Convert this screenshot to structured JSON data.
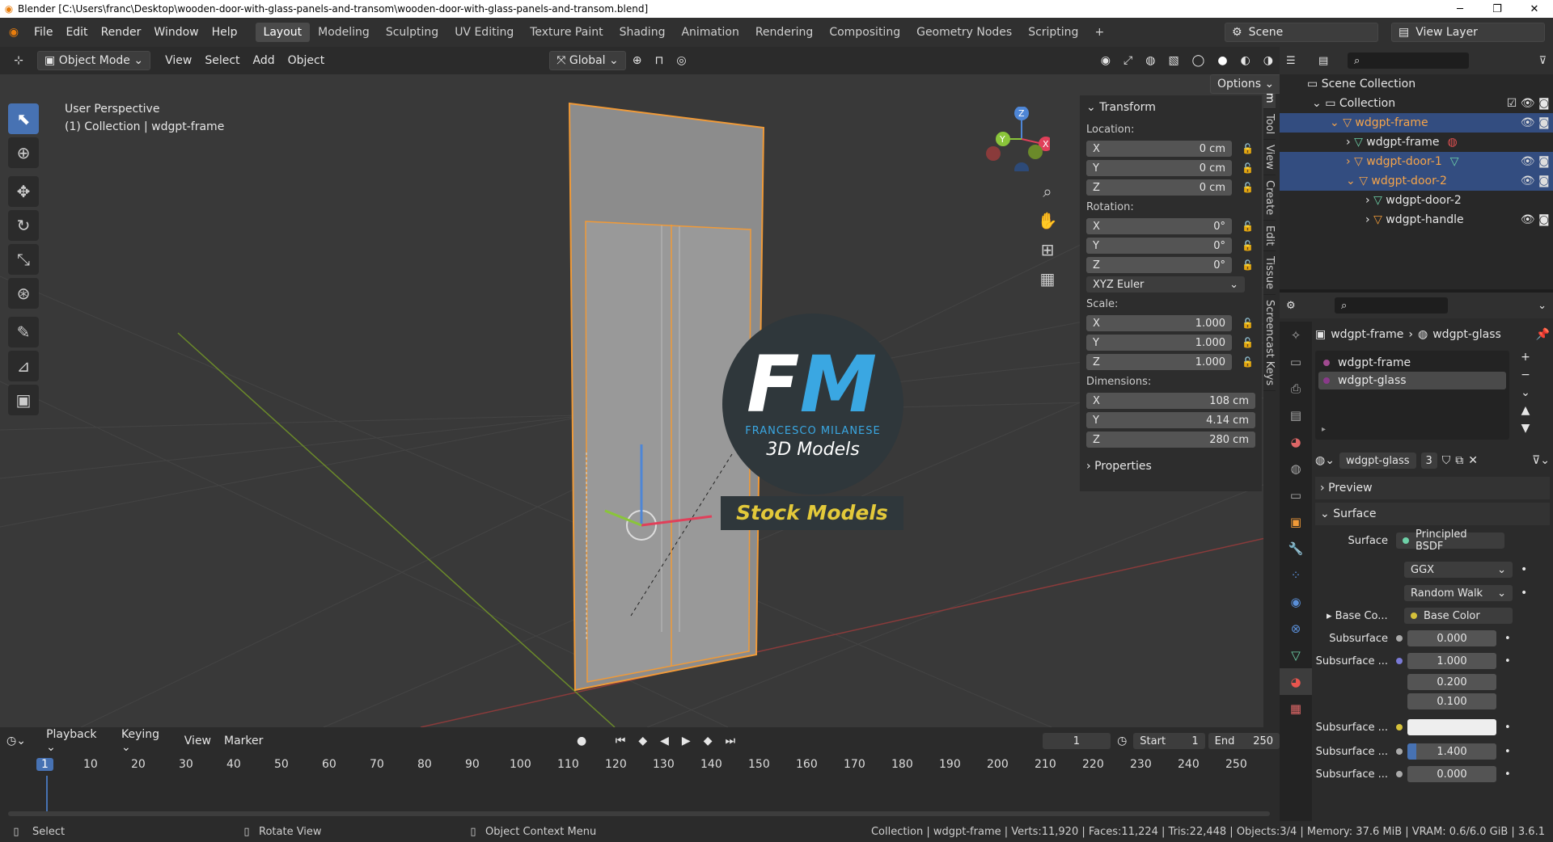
{
  "window": {
    "title": "Blender [C:\\Users\\franc\\Desktop\\wooden-door-with-glass-panels-and-transom\\wooden-door-with-glass-panels-and-transom.blend]",
    "controls": [
      "─",
      "❐",
      "✕"
    ]
  },
  "menubar": {
    "items": [
      "File",
      "Edit",
      "Render",
      "Window",
      "Help"
    ],
    "workspaces": [
      "Layout",
      "Modeling",
      "Sculpting",
      "UV Editing",
      "Texture Paint",
      "Shading",
      "Animation",
      "Rendering",
      "Compositing",
      "Geometry Nodes",
      "Scripting"
    ],
    "active_workspace": "Layout",
    "add_tab": "+",
    "scene": "Scene",
    "view_layer": "View Layer"
  },
  "viewport_header": {
    "mode": "Object Mode",
    "menus": [
      "View",
      "Select",
      "Add",
      "Object"
    ],
    "orientation": "Global",
    "options": "Options"
  },
  "viewport": {
    "perspective": "User Perspective",
    "collection_info": "(1) Collection | wdgpt-frame",
    "watermark_initials_f": "F",
    "watermark_initials_m": "M",
    "watermark_name": "FRANCESCO MILANESE",
    "watermark_sub": "3D Models",
    "watermark_banner": "Stock Models",
    "gizmo_axes": [
      "X",
      "Y",
      "Z"
    ]
  },
  "sidebar_tabs": [
    "Item",
    "Tool",
    "View",
    "Create",
    "Edit",
    "Tissue",
    "Screencast Keys"
  ],
  "transform": {
    "header": "Transform",
    "location_label": "Location:",
    "location": [
      {
        "axis": "X",
        "value": "0 cm"
      },
      {
        "axis": "Y",
        "value": "0 cm"
      },
      {
        "axis": "Z",
        "value": "0 cm"
      }
    ],
    "rotation_label": "Rotation:",
    "rotation": [
      {
        "axis": "X",
        "value": "0°"
      },
      {
        "axis": "Y",
        "value": "0°"
      },
      {
        "axis": "Z",
        "value": "0°"
      }
    ],
    "rotation_mode": "XYZ Euler",
    "scale_label": "Scale:",
    "scale": [
      {
        "axis": "X",
        "value": "1.000"
      },
      {
        "axis": "Y",
        "value": "1.000"
      },
      {
        "axis": "Z",
        "value": "1.000"
      }
    ],
    "dimensions_label": "Dimensions:",
    "dimensions": [
      {
        "axis": "X",
        "value": "108 cm"
      },
      {
        "axis": "Y",
        "value": "4.14 cm"
      },
      {
        "axis": "Z",
        "value": "280 cm"
      }
    ],
    "properties_header": "Properties"
  },
  "outliner": {
    "rows": [
      {
        "label": "Scene Collection"
      },
      {
        "label": "Collection"
      },
      {
        "label": "wdgpt-frame"
      },
      {
        "label": "wdgpt-frame"
      },
      {
        "label": "wdgpt-door-1"
      },
      {
        "label": "wdgpt-door-2"
      },
      {
        "label": "wdgpt-door-2"
      },
      {
        "label": "wdgpt-handle"
      }
    ]
  },
  "properties": {
    "breadcrumb_object": "wdgpt-frame",
    "breadcrumb_material": "wdgpt-glass",
    "material_slots": [
      "wdgpt-frame",
      "wdgpt-glass"
    ],
    "material_name": "wdgpt-glass",
    "users": "3",
    "preview": "Preview",
    "surface_header": "Surface",
    "surface_label": "Surface",
    "surface_value": "Principled BSDF",
    "distribution": "GGX",
    "subsurface_method": "Random Walk",
    "base_color_label": "Base Co...",
    "base_color_value": "Base Color",
    "subsurface_label": "Subsurface",
    "subsurface_value": "0.000",
    "subsurface_radius_label": "Subsurface ...",
    "subsurface_radius": [
      "1.000",
      "0.200",
      "0.100"
    ],
    "subsurface_color_label": "Subsurface ...",
    "subsurface_ior_label": "Subsurface ...",
    "subsurface_ior": "1.400",
    "subsurface_aniso_label": "Subsurface ...",
    "subsurface_aniso": "0.000"
  },
  "timeline": {
    "menus": [
      "Playback",
      "Keying",
      "View",
      "Marker"
    ],
    "current_frame": "1",
    "start_label": "Start",
    "start": "1",
    "end_label": "End",
    "end": "250",
    "ticks": [
      "1",
      "10",
      "20",
      "30",
      "40",
      "50",
      "60",
      "70",
      "80",
      "90",
      "100",
      "110",
      "120",
      "130",
      "140",
      "150",
      "160",
      "170",
      "180",
      "190",
      "200",
      "210",
      "220",
      "230",
      "240",
      "250"
    ]
  },
  "statusbar": {
    "select": "Select",
    "rotate": "Rotate View",
    "context": "Object Context Menu",
    "stats": "Collection | wdgpt-frame | Verts:11,920 | Faces:11,224 | Tris:22,448 | Objects:3/4 | Memory: 37.6 MiB | VRAM: 0.6/6.0 GiB | 3.6.1"
  },
  "colors": {
    "accent": "#4772b3",
    "selection_orange": "#f09a38",
    "selected_row": "#334d80"
  }
}
